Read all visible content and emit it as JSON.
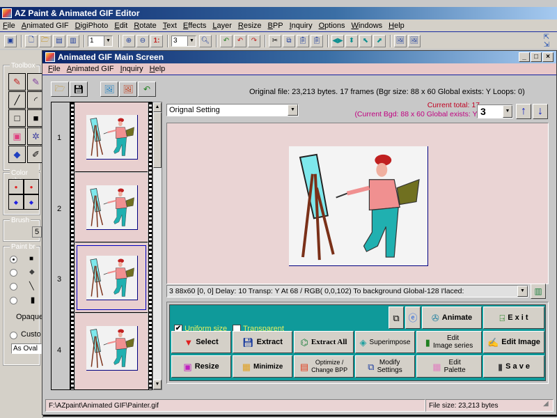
{
  "app": {
    "title": "AZ Paint & Animated GIF Editor",
    "menu": [
      "File",
      "Animated GIF",
      "DigiPhoto",
      "Edit",
      "Rotate",
      "Text",
      "Effects",
      "Layer",
      "Resize",
      "BPP",
      "Inquiry",
      "Options",
      "Windows",
      "Help"
    ],
    "toolbar": {
      "zoom_combo_1": "1",
      "zoom_combo_2": "3",
      "icons": [
        "screen-capture-icon",
        "new-icon",
        "open-icon",
        "film-new-icon",
        "film-open-icon",
        "zoom-in-icon",
        "zoom-out-icon",
        "actual-size-icon",
        "magnify-icon",
        "undo-all-icon",
        "undo-icon",
        "redo-icon",
        "cut-icon",
        "copy-icon",
        "paste-icon",
        "paste-new-icon",
        "flip-horizontal-icon",
        "flip-vertical-icon",
        "rotate-left-icon",
        "rotate-right-icon",
        "image-icon",
        "photo-icon"
      ]
    }
  },
  "toolbox": {
    "title": "Toolbox",
    "color_label": "Color cha",
    "brush_label": "Brush",
    "brush_size": "5",
    "paint_label": "Paint br",
    "opaque_label": "Opaque",
    "custom_label": "Custo",
    "shape_value": "As Oval"
  },
  "child": {
    "title": "Animated GIF Main Screen",
    "menu": [
      "File",
      "Animated GIF",
      "Inquiry",
      "Help"
    ],
    "info_line": "Original  file:  23,213 bytes.  17 frames  (Bgr size:  88 x 60   Global exists:  Y    Loops: 0)",
    "setting_value": "Orignal Setting",
    "current_total": "Current total:  17",
    "current_bgd": "(Current Bgd: 88 x 60   Global exists:  Y)",
    "frame_selected": "3",
    "frames": [
      {
        "num": "1"
      },
      {
        "num": "2"
      },
      {
        "num": "3"
      },
      {
        "num": "4"
      }
    ],
    "frame_detail": "3   88x60  [0, 0]    Delay: 10    Transp: Y  At 68 / RGB( 0,0,102)    To background    Global-128    I'laced:",
    "options": {
      "uniform_size": {
        "label": "Uniform size",
        "checked": true
      },
      "transparent": {
        "label": "Transparent",
        "checked": false
      }
    },
    "buttons": {
      "animate": "Animate",
      "exit": "E x i t",
      "select": "Select",
      "extract": "Extract",
      "extract_all": "Extract All",
      "superimpose": "Superimpose",
      "edit_series_1": "Edit",
      "edit_series_2": "Image series",
      "edit_image": "Edit Image",
      "resize": "Resize",
      "minimize": "Minimize",
      "optimize_1": "Optimize /",
      "optimize_2": "Change BPP",
      "modify_1": "Modify",
      "modify_2": "Settings",
      "palette_1": "Edit",
      "palette_2": "Palette",
      "save": "S a v e"
    },
    "status": {
      "path": "F:\\AZpaint\\Animated GIF\\Painter.gif",
      "file_size": "File size:   23,213  bytes"
    }
  },
  "colors": {
    "title_bar": "#0a246a",
    "panel_teal": "#0f9a9a",
    "pink_bg": "#ead4d4",
    "info_red": "#c00020",
    "info_magenta": "#c00080",
    "option_yellow": "#e8f060"
  }
}
